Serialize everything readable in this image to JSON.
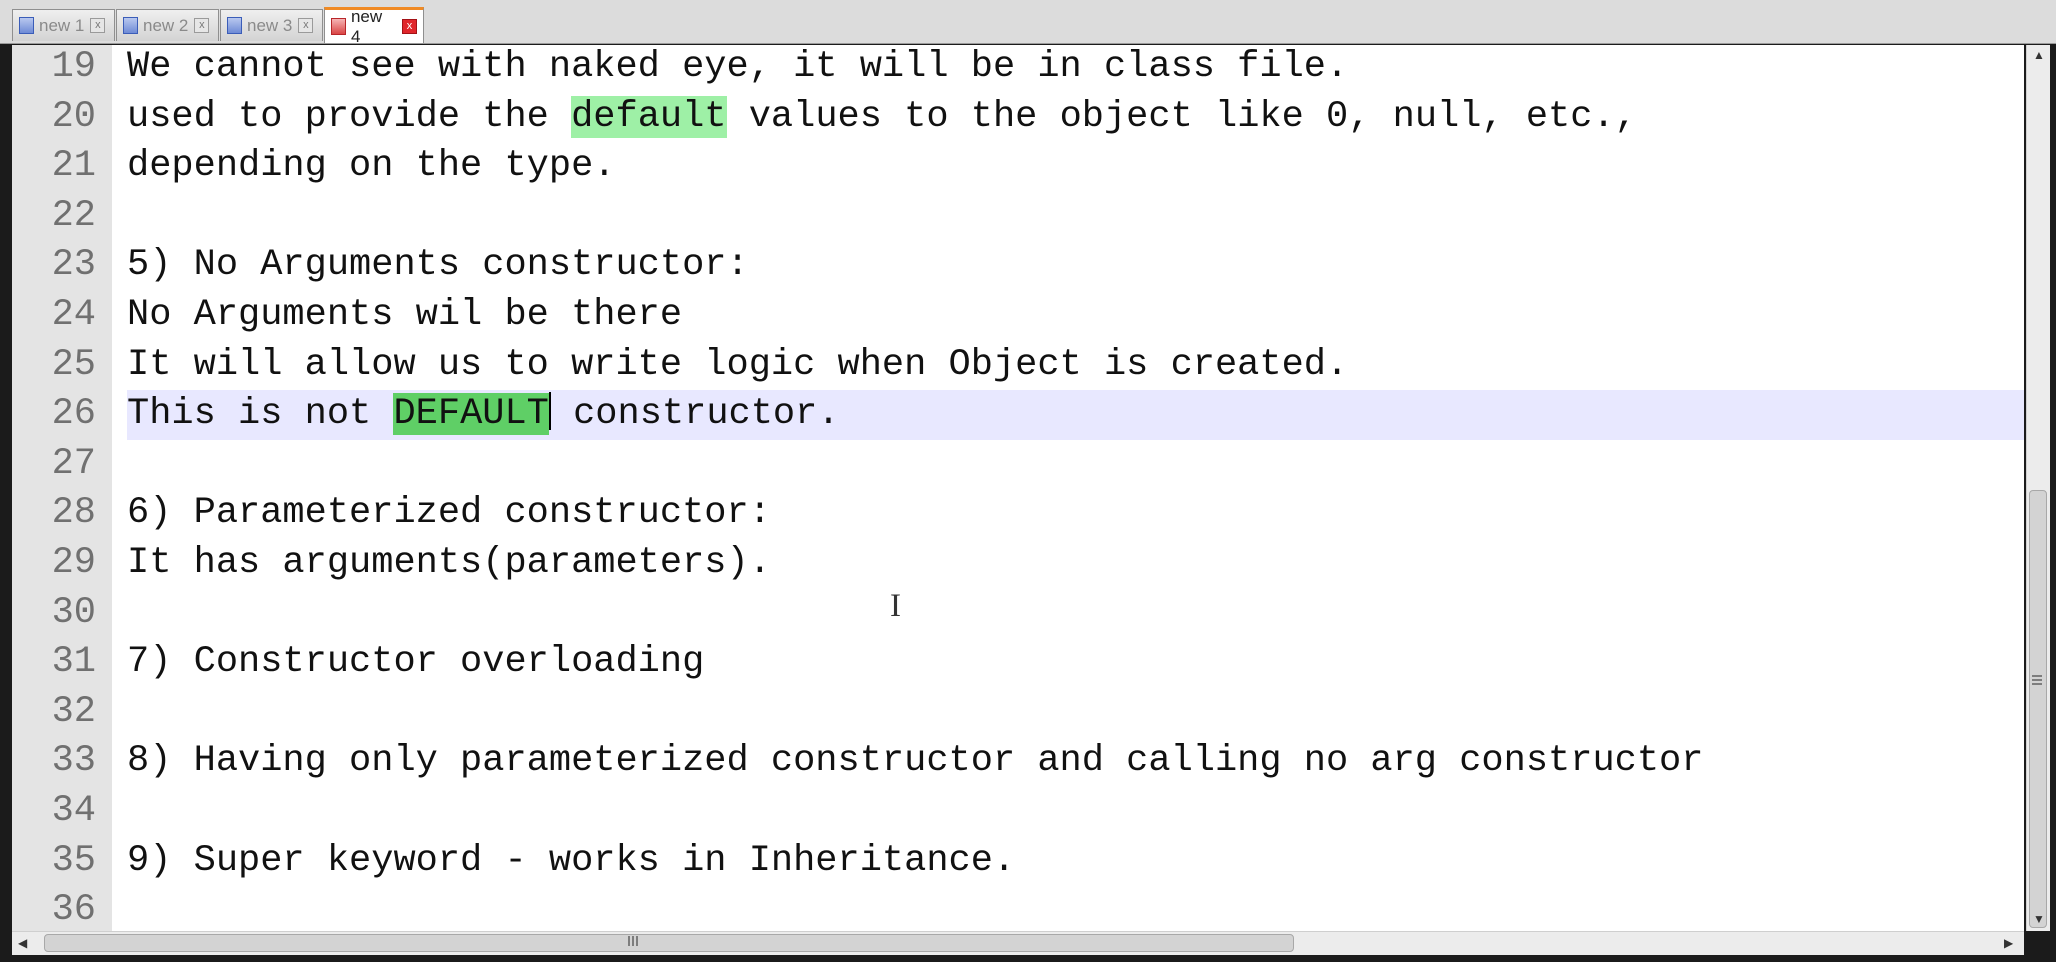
{
  "tabs": [
    {
      "label": "new 1"
    },
    {
      "label": "new 2"
    },
    {
      "label": "new 3"
    },
    {
      "label": "new 4"
    }
  ],
  "active_tab": "new 4",
  "editor": {
    "lines": [
      {
        "n": "19",
        "segments": [
          {
            "t": "We cannot see with naked eye, it will be in class file."
          }
        ]
      },
      {
        "n": "20",
        "segments": [
          {
            "t": "used to provide the "
          },
          {
            "t": "default",
            "hl": "match"
          },
          {
            "t": " values to the object like 0, null, etc.,"
          }
        ]
      },
      {
        "n": "21",
        "segments": [
          {
            "t": "depending on the type."
          }
        ]
      },
      {
        "n": "22",
        "segments": []
      },
      {
        "n": "23",
        "segments": [
          {
            "t": "5) No Arguments constructor:"
          }
        ]
      },
      {
        "n": "24",
        "segments": [
          {
            "t": "No Arguments wil be there"
          }
        ]
      },
      {
        "n": "25",
        "segments": [
          {
            "t": "It will allow us to write logic when Object is created."
          }
        ]
      },
      {
        "n": "26",
        "current": true,
        "segments": [
          {
            "t": "This is not "
          },
          {
            "t": "DEFAULT",
            "hl": "selected"
          },
          {
            "caret": true
          },
          {
            "t": " constructor."
          }
        ]
      },
      {
        "n": "27",
        "segments": []
      },
      {
        "n": "28",
        "segments": [
          {
            "t": "6) Parameterized constructor:"
          }
        ]
      },
      {
        "n": "29",
        "segments": [
          {
            "t": "It has arguments(parameters)."
          }
        ]
      },
      {
        "n": "30",
        "segments": []
      },
      {
        "n": "31",
        "segments": [
          {
            "t": "7) Constructor overloading"
          }
        ]
      },
      {
        "n": "32",
        "segments": []
      },
      {
        "n": "33",
        "segments": [
          {
            "t": "8) Having only parameterized constructor and calling no arg constructor"
          }
        ]
      },
      {
        "n": "34",
        "segments": []
      },
      {
        "n": "35",
        "segments": [
          {
            "t": "9) Super keyword - works in Inheritance."
          }
        ]
      },
      {
        "n": "36",
        "segments": []
      }
    ]
  },
  "icons": {
    "tab_doc": "document-icon",
    "tab_close": "close-icon",
    "mouse_cursor": "i-beam-cursor-icon"
  },
  "colors": {
    "match_highlight": "#9ef0a6",
    "selection_highlight": "#5fcf66",
    "current_line": "#e8e8ff",
    "active_tab_accent": "#f08a24",
    "close_button_active": "#e0262b"
  }
}
